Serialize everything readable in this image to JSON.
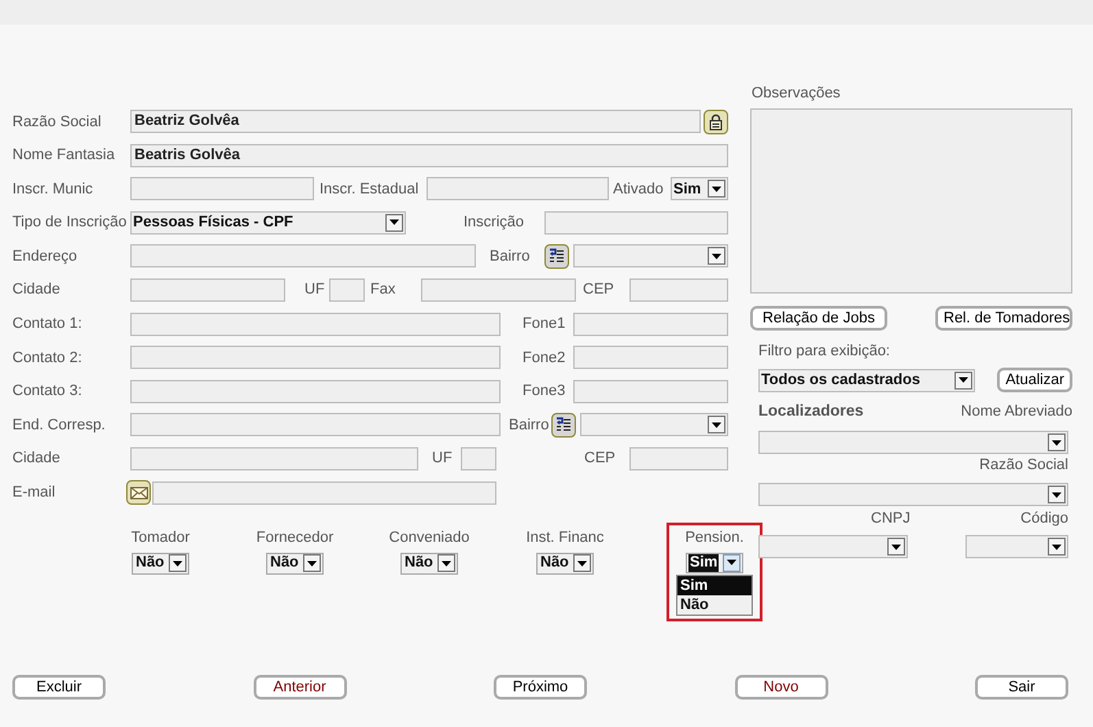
{
  "form_rows": [
    {
      "items": [
        {
          "kind": "label",
          "text": "Razão Social"
        },
        {
          "kind": "input",
          "value": "Beatriz Golvêa"
        },
        {
          "kind": "lock_button"
        }
      ]
    },
    {
      "items": [
        {
          "kind": "label",
          "text": "Nome Fantasia"
        },
        {
          "kind": "input",
          "value": "Beatris Golvêa"
        }
      ]
    },
    {
      "items": [
        {
          "kind": "label",
          "text": "Inscr. Munic"
        },
        {
          "kind": "input"
        },
        {
          "kind": "label",
          "text": "Inscr. Estadual"
        },
        {
          "kind": "input"
        },
        {
          "kind": "label",
          "text": "Ativado"
        },
        {
          "kind": "select",
          "value": "Sim"
        }
      ]
    },
    {
      "items": [
        {
          "kind": "label",
          "text": "Tipo de Inscrição"
        },
        {
          "kind": "select",
          "value": "Pessoas Físicas - CPF"
        },
        {
          "kind": "label",
          "text": "Inscrição"
        },
        {
          "kind": "input"
        }
      ]
    },
    {
      "items": [
        {
          "kind": "label",
          "text": "Endereço"
        },
        {
          "kind": "input"
        },
        {
          "kind": "label",
          "text": "Bairro"
        },
        {
          "kind": "lookup_button"
        },
        {
          "kind": "select"
        }
      ]
    },
    {
      "items": [
        {
          "kind": "label",
          "text": "Cidade"
        },
        {
          "kind": "input"
        },
        {
          "kind": "label",
          "text": "UF"
        },
        {
          "kind": "input"
        },
        {
          "kind": "label",
          "text": "Fax"
        },
        {
          "kind": "input"
        },
        {
          "kind": "label",
          "text": "CEP"
        },
        {
          "kind": "input"
        }
      ]
    },
    {
      "items": [
        {
          "kind": "label",
          "text": "Contato 1:"
        },
        {
          "kind": "input"
        },
        {
          "kind": "label",
          "text": "Fone1"
        },
        {
          "kind": "input"
        }
      ]
    },
    {
      "items": [
        {
          "kind": "label",
          "text": "Contato 2:"
        },
        {
          "kind": "input"
        },
        {
          "kind": "label",
          "text": "Fone2"
        },
        {
          "kind": "input"
        }
      ]
    },
    {
      "items": [
        {
          "kind": "label",
          "text": "Contato 3:"
        },
        {
          "kind": "input"
        },
        {
          "kind": "label",
          "text": "Fone3"
        },
        {
          "kind": "input"
        }
      ]
    },
    {
      "items": [
        {
          "kind": "label",
          "text": "End. Corresp."
        },
        {
          "kind": "input"
        },
        {
          "kind": "label",
          "text": "Bairro"
        },
        {
          "kind": "lookup_button"
        },
        {
          "kind": "select"
        }
      ]
    },
    {
      "items": [
        {
          "kind": "label",
          "text": "Cidade"
        },
        {
          "kind": "input"
        },
        {
          "kind": "label",
          "text": "UF"
        },
        {
          "kind": "input"
        },
        {
          "kind": "label",
          "text": "CEP"
        },
        {
          "kind": "input"
        }
      ]
    },
    {
      "items": [
        {
          "kind": "label",
          "text": "E-mail"
        },
        {
          "kind": "mail_button"
        },
        {
          "kind": "input"
        }
      ]
    }
  ],
  "flags": [
    {
      "label": "Tomador",
      "value": "Não",
      "focused": false,
      "highlighted": false,
      "expanded": false
    },
    {
      "label": "Fornecedor",
      "value": "Não",
      "focused": false,
      "highlighted": false,
      "expanded": false
    },
    {
      "label": "Conveniado",
      "value": "Não",
      "focused": false,
      "highlighted": false,
      "expanded": false
    },
    {
      "label": "Inst. Financ",
      "value": "Não",
      "focused": false,
      "highlighted": false,
      "expanded": false
    },
    {
      "label": "Pension.",
      "value": "Sim",
      "focused": true,
      "highlighted": true,
      "expanded": true,
      "options": [
        {
          "text": "Sim",
          "selected": true
        },
        {
          "text": "Não",
          "selected": false
        }
      ]
    }
  ],
  "observacoes": {
    "label": "Observações"
  },
  "report_buttons": [
    "Relação de Jobs",
    "Rel. de Tomadores"
  ],
  "filter": {
    "label": "Filtro para exibição:",
    "value": "Todos os cadastrados",
    "button": "Atualizar"
  },
  "locators": {
    "title": "Localizadores",
    "fields": [
      {
        "label": "Nome Abreviado"
      },
      {
        "label": "Razão Social"
      },
      {
        "label": "CNPJ"
      },
      {
        "label": "Código"
      }
    ]
  },
  "buttons": [
    {
      "label": "Excluir",
      "color": "#000000"
    },
    {
      "label": "Anterior",
      "color": "#800000"
    },
    {
      "label": "Próximo",
      "color": "#000000"
    },
    {
      "label": "Novo",
      "color": "#800000"
    },
    {
      "label": "Sair",
      "color": "#000000"
    }
  ]
}
